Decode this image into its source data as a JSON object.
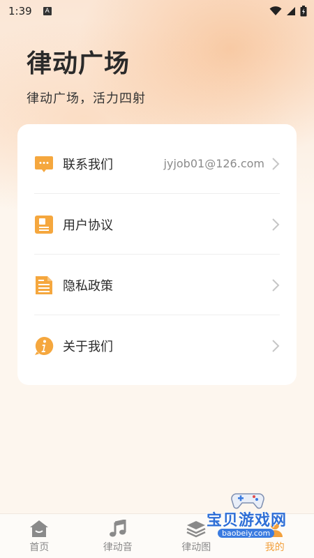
{
  "status_bar": {
    "time": "1:39",
    "notif_letter": "A"
  },
  "header": {
    "title": "律动广场",
    "subtitle": "律动广场，活力四射"
  },
  "menu": {
    "items": [
      {
        "label": "联系我们",
        "value": "jyjob01@126.com",
        "icon": "chat-icon"
      },
      {
        "label": "用户协议",
        "value": "",
        "icon": "document-icon"
      },
      {
        "label": "隐私政策",
        "value": "",
        "icon": "policy-icon"
      },
      {
        "label": "关于我们",
        "value": "",
        "icon": "info-icon"
      }
    ]
  },
  "tabbar": {
    "tabs": [
      {
        "label": "首页",
        "icon": "home-icon"
      },
      {
        "label": "律动音",
        "icon": "music-note-icon"
      },
      {
        "label": "律动图",
        "icon": "layers-icon"
      },
      {
        "label": "我的",
        "icon": "user-icon"
      }
    ],
    "active_index": 3
  },
  "watermark": {
    "text": "宝贝游戏网",
    "url": "baobeiy.com"
  },
  "colors": {
    "accent": "#f5a73e",
    "active_tab": "#f2a03d"
  }
}
